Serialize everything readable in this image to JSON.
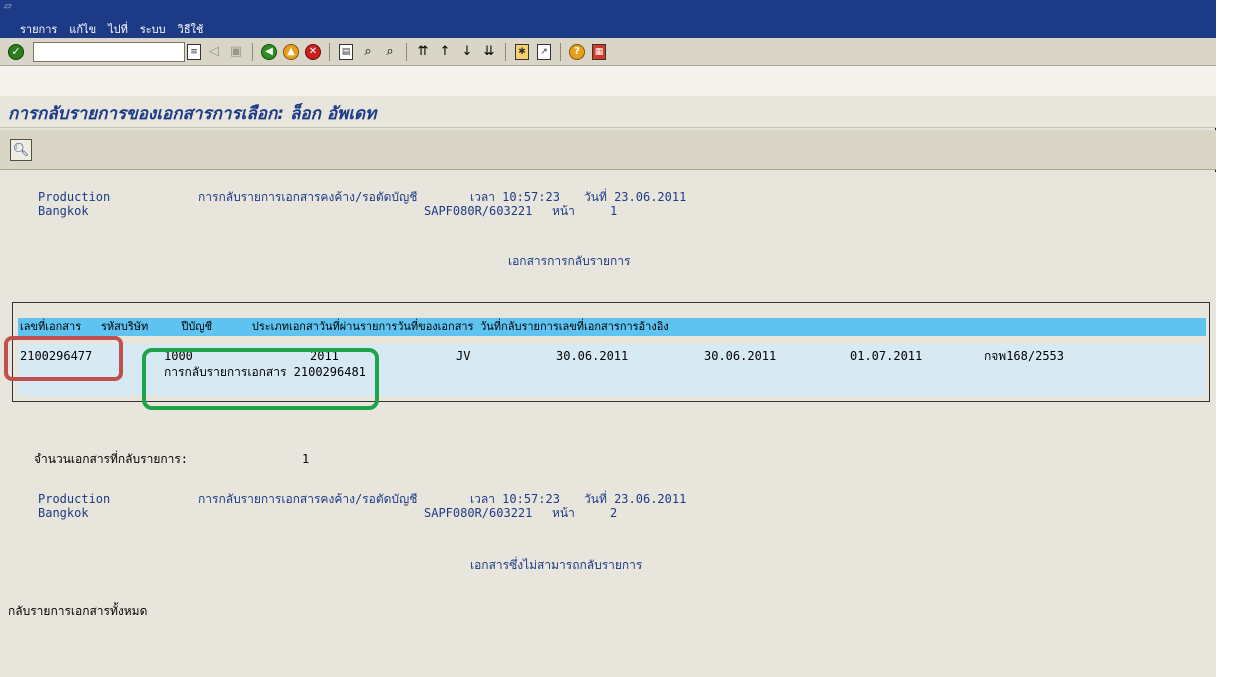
{
  "menu": {
    "items": [
      "รายการ",
      "แก้ไข",
      "ไปที่",
      "ระบบ",
      "วิธีใช้"
    ]
  },
  "toolbar": {
    "command_field_value": "",
    "icons": [
      "enter-icon",
      "command-dropdown-icon",
      "back-nav-icon",
      "save-icon",
      "back-icon",
      "exit-icon",
      "cancel-icon",
      "print-icon",
      "find-icon",
      "find-next-icon",
      "first-page-icon",
      "previous-page-icon",
      "next-page-icon",
      "last-page-icon",
      "create-session-icon",
      "shortcut-icon",
      "help-icon",
      "layout-menu-icon"
    ]
  },
  "title": "การกลับรายการของเอกสารการเลือก: ล็อก อัพเดท",
  "app_toolbar": {
    "icons": [
      "detail-magnify-icon"
    ]
  },
  "report": {
    "page1": {
      "system": "Production",
      "city": "Bangkok",
      "report_name": "การกลับรายการเอกสารคงค้าง/รอตัดบัญชี",
      "time_label": "เวลา 10:57:23",
      "date_label": "วันที่ 23.06.2011",
      "program": "SAPF080R/603221",
      "page_label": "หน้า",
      "page_no": "1",
      "section_title": "เอกสารการกลับรายการ"
    },
    "table": {
      "header": "เลขที่เอกสาร   รหัสบริษัท     ปีบัญชี      ประเภทเอกสาวันที่ผ่านรายการวันที่ของเอกสาร วันที่กลับรายการเลขที่เอกสารการอ้างอิง",
      "row": {
        "doc_no": "2100296477",
        "company_code": "1000",
        "fiscal_year": "2011",
        "doc_type": "JV",
        "posting_date": "30.06.2011",
        "doc_date": "30.06.2011",
        "reversal_date": "01.07.2011",
        "reference": "กจพ168/2553",
        "reversal_doc_text": "การกลับรายการเอกสาร 2100296481"
      }
    },
    "count_label": "จำนวนเอกสารที่กลับรายการ:",
    "count_value": "1",
    "page2": {
      "system": "Production",
      "city": "Bangkok",
      "report_name": "การกลับรายการเอกสารคงค้าง/รอตัดบัญชี",
      "time_label": "เวลา 10:57:23",
      "date_label": "วันที่ 23.06.2011",
      "program": "SAPF080R/603221",
      "page_label": "หน้า",
      "page_no": "2",
      "section_title": "เอกสารซึ่งไม่สามารถกลับรายการ"
    },
    "footer_text": "กลับรายการเอกสารทั้งหมด"
  },
  "colors": {
    "menubar": "#1d3a86",
    "header_row": "#5ec3f0",
    "data_row": "#d7eaf3",
    "highlight_red": "#c0504d",
    "highlight_green": "#1fa34a"
  }
}
